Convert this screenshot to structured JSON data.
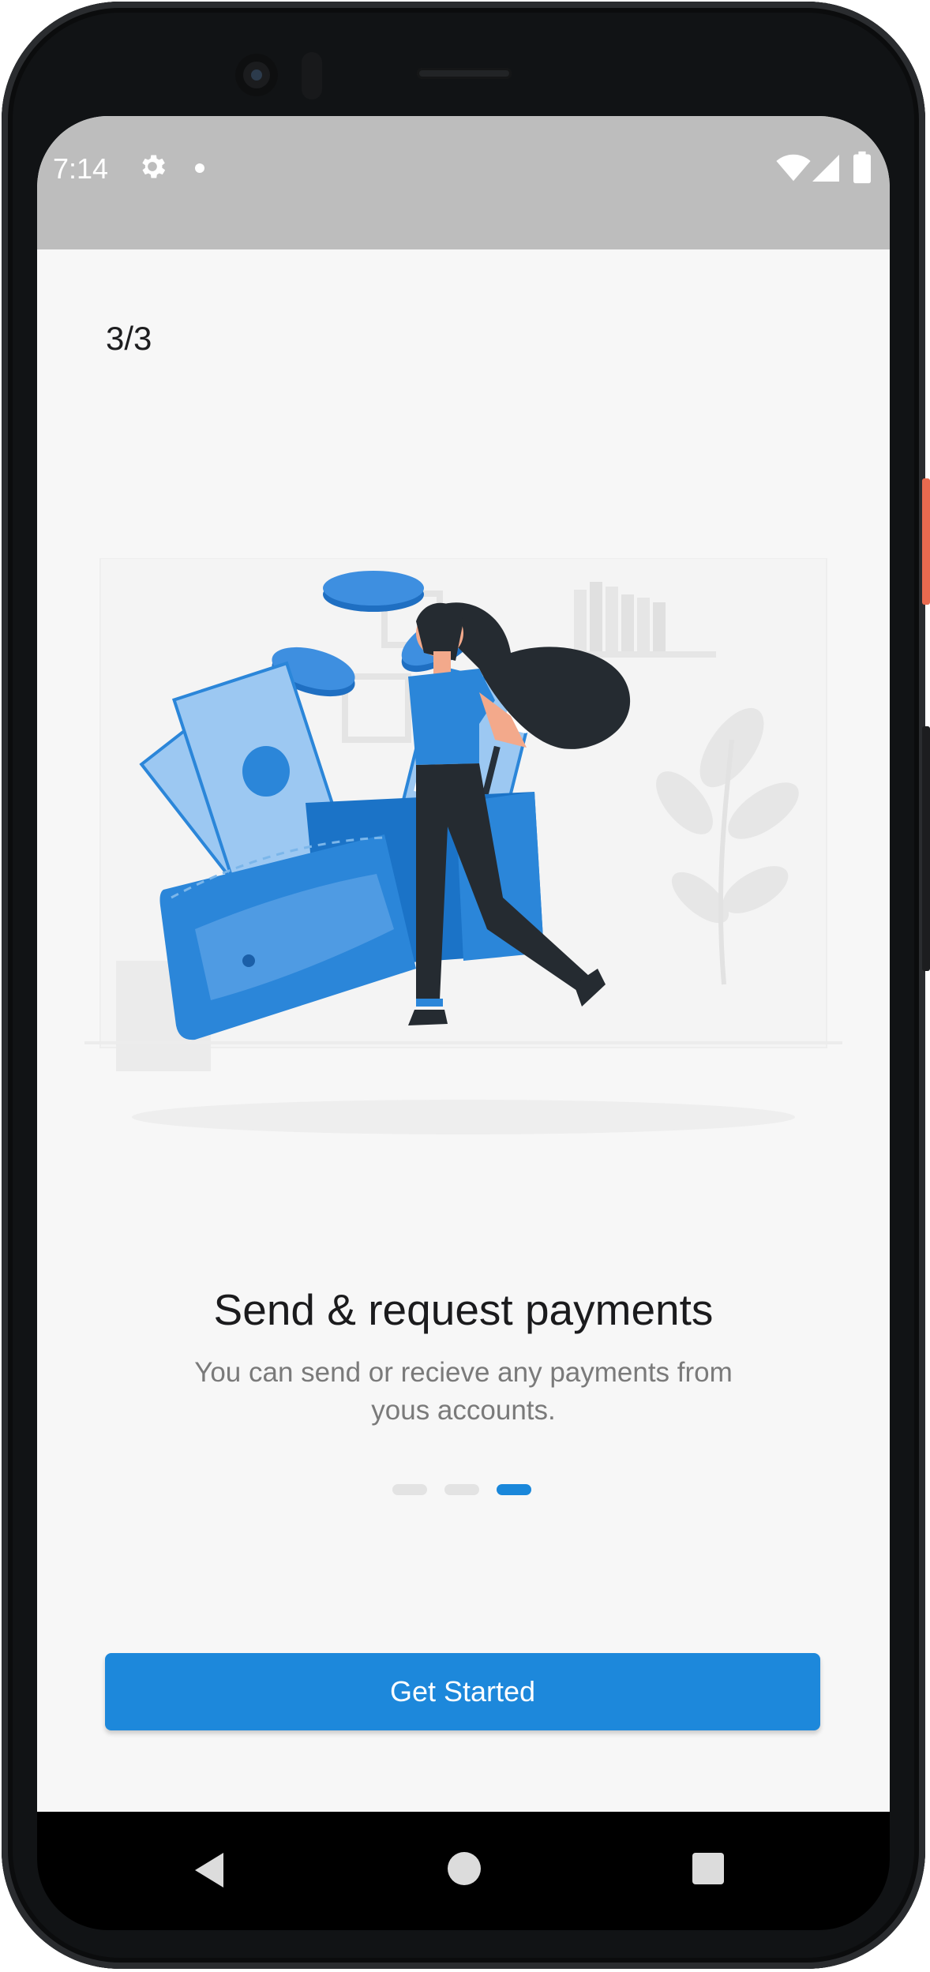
{
  "status_bar": {
    "time": "7:14"
  },
  "onboarding": {
    "step_counter": "3/3",
    "headline": "Send & request payments",
    "subtext": "You can send or recieve any payments from yous accounts.",
    "pager": {
      "current": 3,
      "total": 3
    },
    "cta_label": "Get Started"
  },
  "icons": {
    "status": [
      "gear-icon",
      "notification-dot-icon",
      "wifi-icon",
      "signal-icon",
      "battery-icon"
    ],
    "nav": [
      "back-icon",
      "home-icon",
      "recents-icon"
    ]
  },
  "colors": {
    "accent": "#1d88db",
    "pager_inactive": "#e3e3e3",
    "status_bar": "#bdbdbd",
    "screen_bg": "#f7f7f7"
  }
}
